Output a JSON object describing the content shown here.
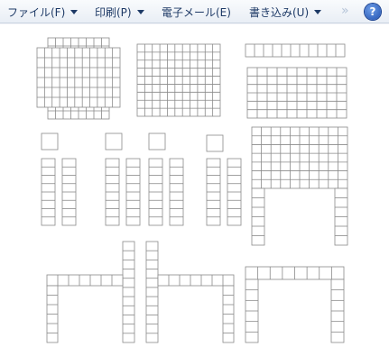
{
  "menu": {
    "file": "ファイル(F)",
    "print": "印刷(P)",
    "email": "電子メール(E)",
    "burn": "書き込み(U)",
    "more": "»",
    "help": "?"
  },
  "icons": {
    "chevron": "chevron-more-icon",
    "help": "help-icon",
    "dropdown": "dropdown-arrow-icon"
  },
  "colors": {
    "menu_text": "#1e3a66",
    "toolbar_bg": "#eef2f7",
    "grid_stroke": "#8a8a8a"
  }
}
